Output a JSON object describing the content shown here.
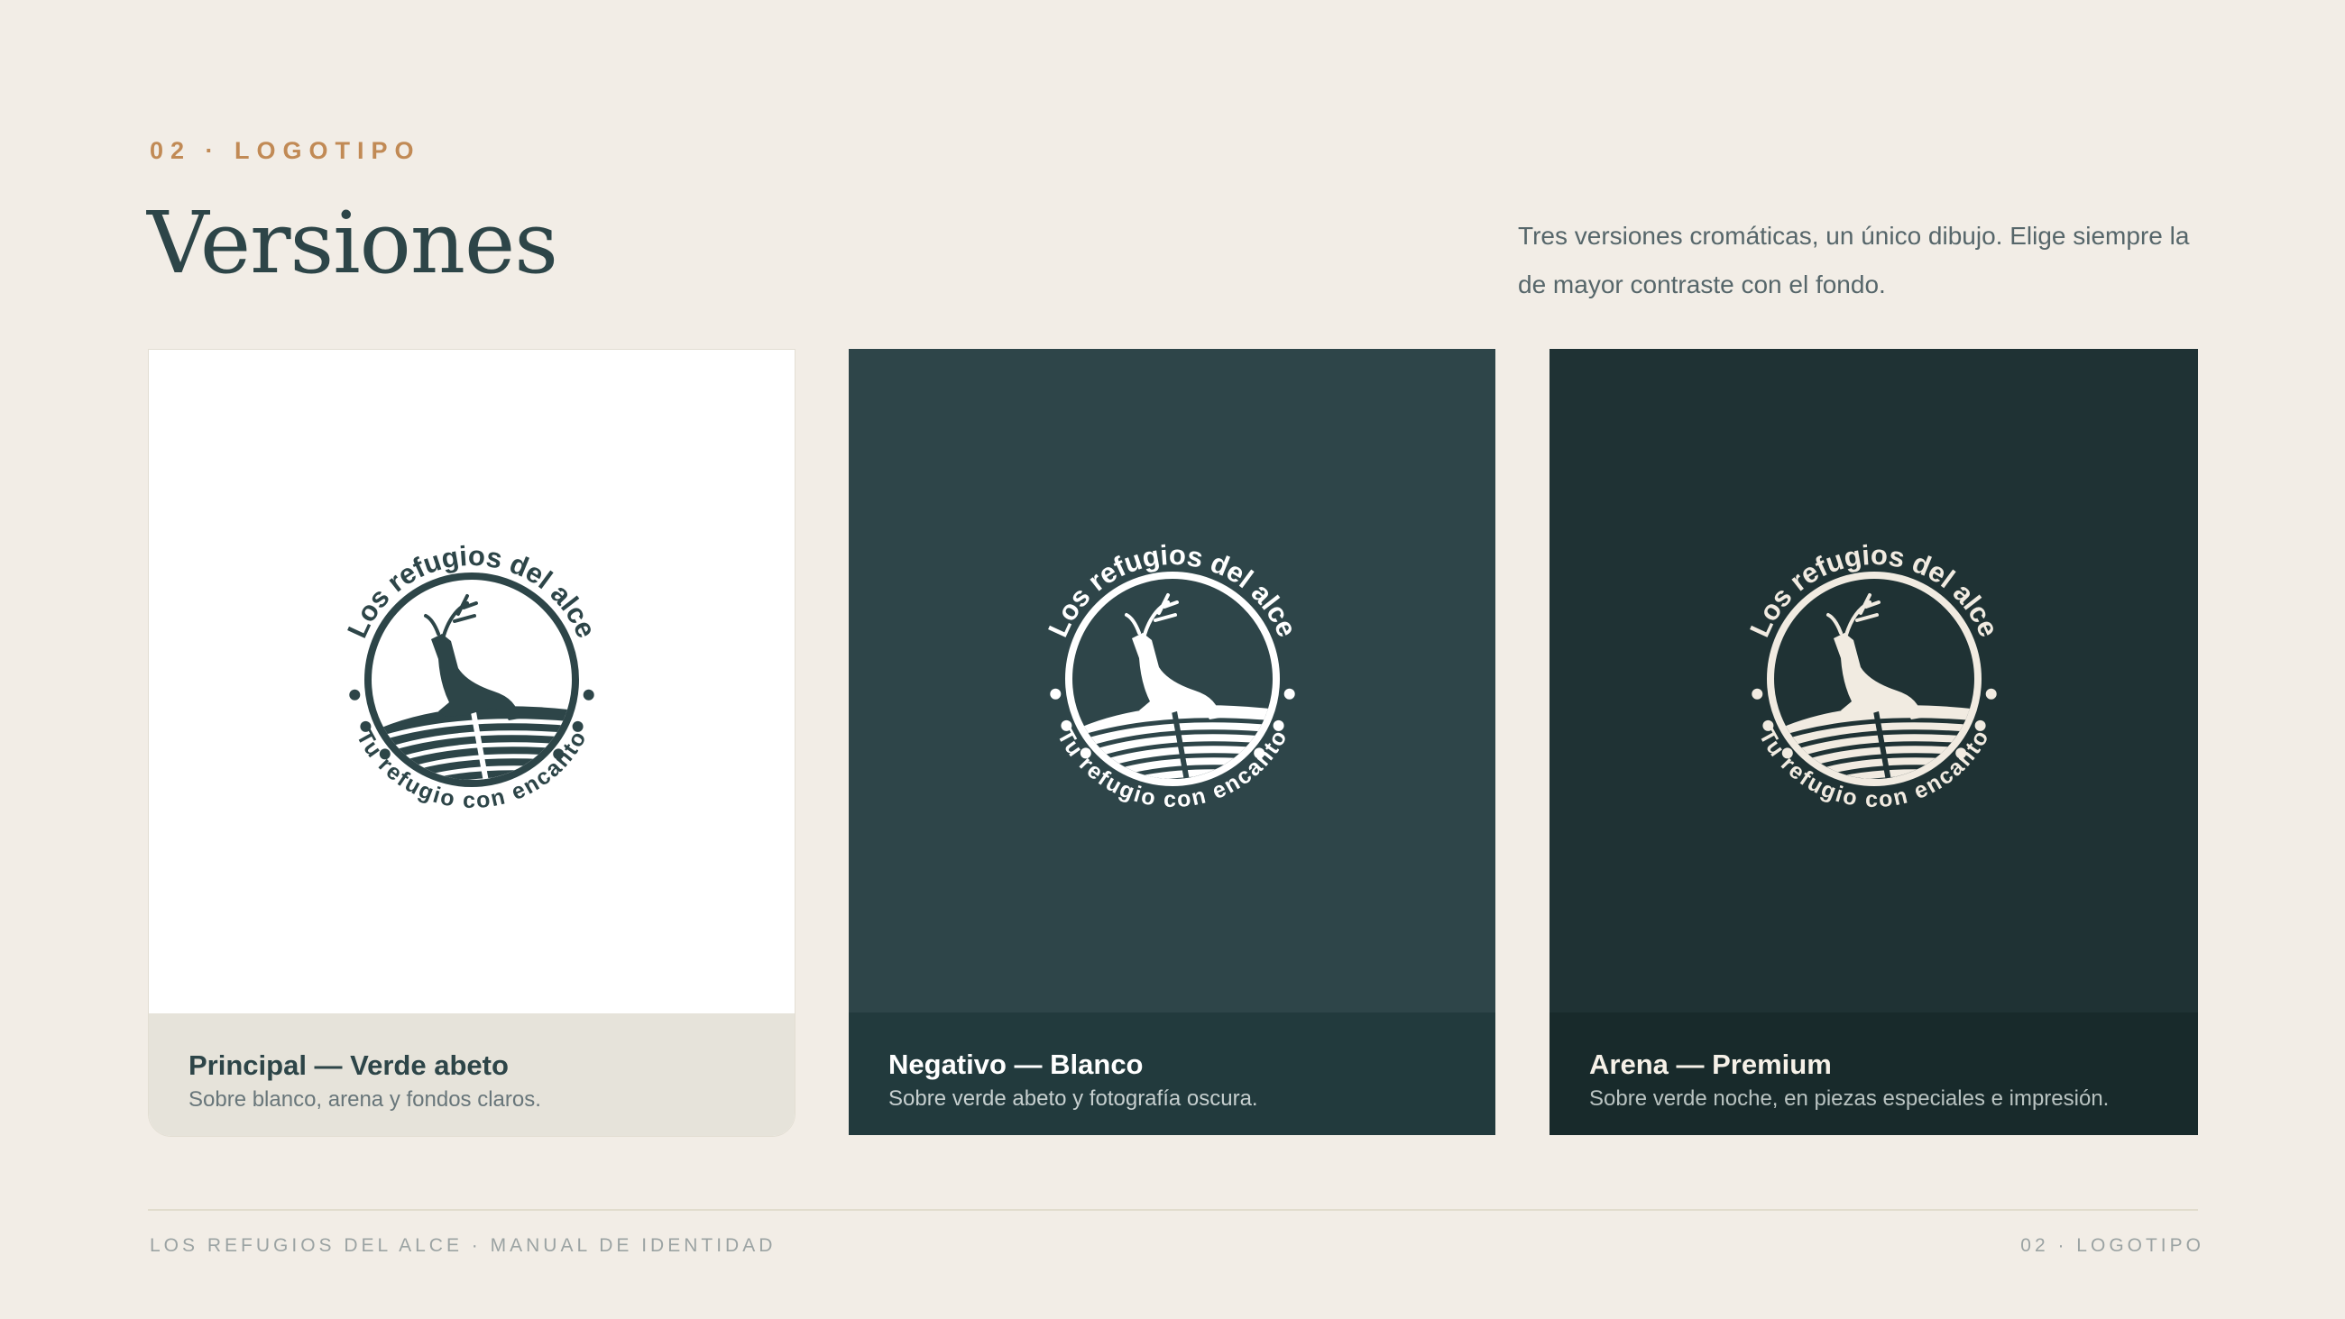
{
  "header": {
    "eyebrow": "02 · LOGOTIPO",
    "title": "Versiones",
    "intro": "Tres versiones cromáticas, un único dibujo. Elige siempre la de mayor contraste con el fondo."
  },
  "logo": {
    "top_text": "Los refugios del alce",
    "bottom_text": "Tu refugio con encanto"
  },
  "versions": [
    {
      "title": "Principal — Verde abeto",
      "description": "Sobre blanco, arena y fondos claros.",
      "logo_color": "#2d4548",
      "background": "#ffffff"
    },
    {
      "title": "Negativo — Blanco",
      "description": "Sobre verde abeto y fotografía oscura.",
      "logo_color": "#ffffff",
      "background": "#2e4549"
    },
    {
      "title": "Arena — Premium",
      "description": "Sobre verde noche, en piezas especiales e impresión.",
      "logo_color": "#f1ebe1",
      "background": "#1f3234"
    }
  ],
  "footer": {
    "left": "LOS REFUGIOS DEL ALCE · MANUAL DE IDENTIDAD",
    "right": "02 · LOGOTIPO"
  }
}
